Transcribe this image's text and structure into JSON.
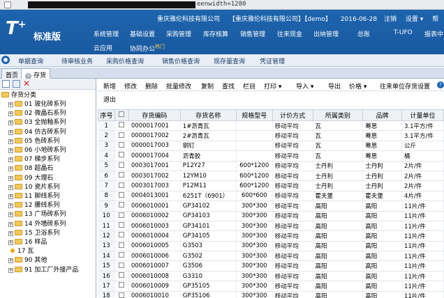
{
  "address_bar": {
    "visible_text": "eenwidth=1280"
  },
  "header": {
    "logo": {
      "brand": "T",
      "brand_sup": "+",
      "edition": "标准版"
    },
    "company_name": "重庆雅伦科技有限公司",
    "account_label": "【重庆雅伦科技有限公司】【demo】",
    "date": "2016-06-28",
    "logout": "注销",
    "settings": "设置",
    "settings_arrow": "▾",
    "help": "帮",
    "menu_row1": [
      "系统管理",
      "基础设置",
      "采购管理",
      "库存核算",
      "销售管理",
      "往来现金",
      "出纳管理",
      "总账",
      "T-UFO",
      "报表中"
    ],
    "menu_row2": [
      "云应用",
      "协同办公"
    ],
    "hot_badge": "热门"
  },
  "subbar": {
    "items": [
      "单据查询",
      "待审核业务",
      "采购价格查询",
      "销售价格查询",
      "现存量查询",
      "凭证管理"
    ]
  },
  "tabs": [
    {
      "label": "首页",
      "active": false,
      "closable": false
    },
    {
      "label": "存货",
      "active": true,
      "closable": true
    }
  ],
  "left_panel": {
    "tree_root": "存货分类",
    "nodes": [
      "01 玻化砖系列",
      "02 微晶石系列",
      "03 全抛釉系列",
      "04 仿古砖系列",
      "05 色砖系列",
      "06 小地砖系列",
      "07 梯步系列",
      "08 超晶石",
      "09 大理石",
      "10 瓷片系列",
      "11 脚线系列",
      "12 腰线系列",
      "13 广场砖系列",
      "14 外墙砖系列",
      "15 卫浴系列",
      "16 样品",
      "17 瓦",
      "90 其他",
      "91 加工厂外接产品"
    ]
  },
  "toolbar": {
    "buttons": [
      "新增",
      "修改",
      "删除",
      "批量修改",
      "复制",
      "查找",
      "栏目",
      "打印 ▾",
      "导入 ▾",
      "导出",
      "价格 ▾",
      "往来单位存货设置"
    ],
    "help_icon": "?",
    "exit": "退出"
  },
  "grid": {
    "headers": [
      "序号",
      "",
      "存货编码",
      "存货名称",
      "规格型号",
      "计价方式",
      "所属类别",
      "品牌",
      "计量单位"
    ],
    "rows": [
      [
        "1",
        "0000017001",
        "1#沥青瓦",
        "",
        "移动平均",
        "瓦",
        "蓦思",
        "3.1平方/件"
      ],
      [
        "2",
        "0000017002",
        "2#沥青瓦",
        "",
        "移动平均",
        "瓦",
        "蓦思",
        "3.1平方/件"
      ],
      [
        "3",
        "0000017003",
        "钢钉",
        "",
        "移动平均",
        "瓦",
        "蓦思",
        "公斤"
      ],
      [
        "4",
        "0000017004",
        "沥青胶",
        "",
        "移动平均",
        "瓦",
        "蓦思",
        "桶"
      ],
      [
        "5",
        "0003017001",
        "P12Y27",
        "600*1200",
        "移动平均",
        "士丹利",
        "士丹利",
        "2片/件"
      ],
      [
        "6",
        "0003017002",
        "12YM10",
        "600*1200",
        "移动平均",
        "士丹利",
        "士丹利",
        "2片/件"
      ],
      [
        "7",
        "0003017003",
        "P12M11",
        "600*1200",
        "移动平均",
        "士丹利",
        "士丹利",
        "2片/件"
      ],
      [
        "8",
        "0004013001",
        "6251T（6901）",
        "600*600",
        "移动平均",
        "霍夫堡",
        "霍夫堡",
        "4片/件"
      ],
      [
        "9",
        "0006010001",
        "GP34102",
        "300*300",
        "移动平均",
        "高阳",
        "高阳",
        "11片/件"
      ],
      [
        "10",
        "0006010002",
        "GP34103",
        "300*300",
        "移动平均",
        "高阳",
        "高阳",
        "11片/件"
      ],
      [
        "11",
        "0006010003",
        "GP34101",
        "300*300",
        "移动平均",
        "高阳",
        "高阳",
        "11片/件"
      ],
      [
        "12",
        "0006010004",
        "GP34105",
        "300*300",
        "移动平均",
        "高阳",
        "高阳",
        "11片/件"
      ],
      [
        "13",
        "0006010005",
        "G3503",
        "300*300",
        "移动平均",
        "高阳",
        "高阳",
        "11片/件"
      ],
      [
        "14",
        "0006010006",
        "G3502",
        "300*300",
        "移动平均",
        "高阳",
        "高阳",
        "11片/件"
      ],
      [
        "15",
        "0006010007",
        "G3506",
        "300*300",
        "移动平均",
        "高阳",
        "高阳",
        "11片/件"
      ],
      [
        "16",
        "0006010008",
        "G3310",
        "300*300",
        "移动平均",
        "高阳",
        "高阳",
        "11片/件"
      ],
      [
        "17",
        "0006010009",
        "GP35105",
        "300*300",
        "移动平均",
        "高阳",
        "高阳",
        "11片/件"
      ],
      [
        "18",
        "0006010010",
        "GP35106",
        "300*300",
        "移动平均",
        "高阳",
        "高阳",
        "11片/件"
      ]
    ]
  },
  "colors": {
    "header_blue": "#1d64ae",
    "accent_yellow": "#ffd24a"
  }
}
